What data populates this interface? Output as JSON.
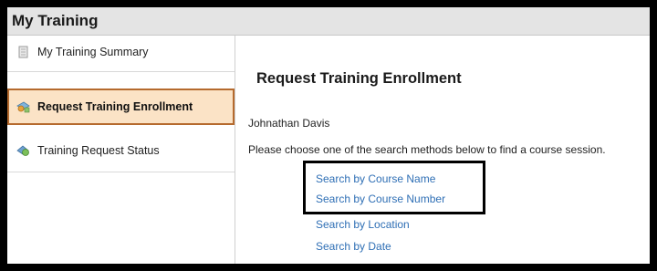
{
  "window": {
    "title": "My Training"
  },
  "sidebar": {
    "items": [
      {
        "label": "My Training Summary",
        "icon": "document-icon",
        "active": false
      },
      {
        "label": "Request Training Enrollment",
        "icon": "enrollment-icon",
        "active": true
      },
      {
        "label": "Training Request Status",
        "icon": "status-icon",
        "active": false
      }
    ]
  },
  "main": {
    "heading": "Request Training Enrollment",
    "user_name": "Johnathan Davis",
    "instructions": "Please choose one of the search methods below to find a course session.",
    "search_links": [
      "Search by Course Name",
      "Search by Course Number",
      "Search by Location",
      "Search by Date"
    ]
  },
  "colors": {
    "link": "#2f6fb5",
    "active_bg": "#fbe3c6",
    "active_border": "#b56a2e",
    "titlebar_bg": "#e4e4e4"
  }
}
